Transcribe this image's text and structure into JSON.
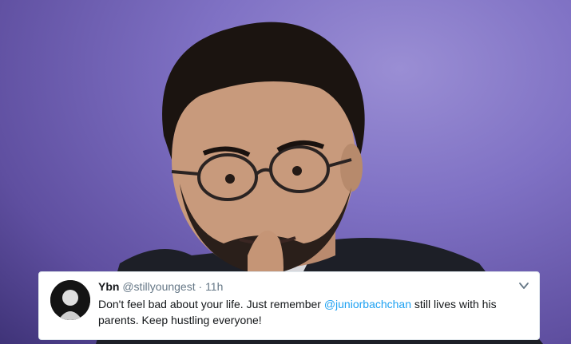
{
  "tweet": {
    "display_name": "Ybn",
    "handle": "@stillyoungest",
    "separator": "·",
    "time": "11h",
    "text_before_mention": "Don't feel bad about your life. Just remember ",
    "mention": "@juniorbachchan",
    "text_after_mention": " still lives with his parents. Keep hustling everyone!",
    "menu_icon": "chevron-down-icon"
  },
  "colors": {
    "background": "#7f71c4",
    "card": "#ffffff",
    "mention": "#1da1f2",
    "muted": "#657786"
  }
}
